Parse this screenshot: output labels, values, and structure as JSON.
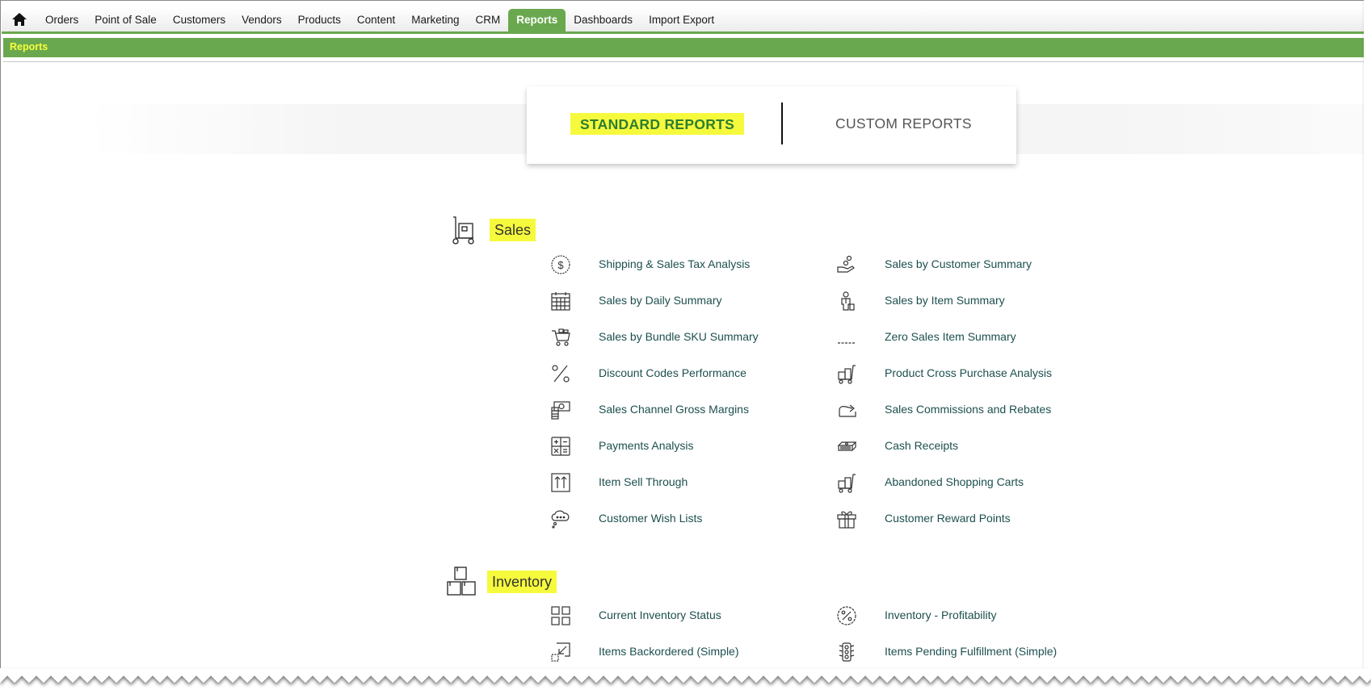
{
  "nav": {
    "home_icon": "home-icon",
    "items": [
      "Orders",
      "Point of Sale",
      "Customers",
      "Vendors",
      "Products",
      "Content",
      "Marketing",
      "CRM",
      "Reports",
      "Dashboards",
      "Import Export"
    ],
    "active": "Reports"
  },
  "breadcrumb": "Reports",
  "tabs": {
    "standard": "STANDARD REPORTS",
    "custom": "CUSTOM REPORTS",
    "active": "STANDARD REPORTS"
  },
  "colors": {
    "accent": "#6aa84f",
    "highlight": "#f6fa3c",
    "link": "#1d4f4f",
    "active_tab_text": "#2e7d32"
  },
  "sections": [
    {
      "title": "Sales",
      "icon": "hand-truck-icon",
      "reports": [
        {
          "label": "Shipping & Sales Tax Analysis",
          "icon": "dollar-coin-icon"
        },
        {
          "label": "Sales by Customer Summary",
          "icon": "hand-coins-icon"
        },
        {
          "label": "Sales by Daily Summary",
          "icon": "calendar-icon"
        },
        {
          "label": "Sales by Item Summary",
          "icon": "person-icon"
        },
        {
          "label": "Sales by Bundle SKU Summary",
          "icon": "shopping-cart-icon"
        },
        {
          "label": "Zero Sales Item Summary",
          "icon": "dashes-icon"
        },
        {
          "label": "Discount Codes Performance",
          "icon": "percent-icon"
        },
        {
          "label": "Product Cross Purchase Analysis",
          "icon": "cart-boxes-icon"
        },
        {
          "label": "Sales Channel Gross Margins",
          "icon": "cash-stack-icon"
        },
        {
          "label": "Sales Commissions and Rebates",
          "icon": "return-arrow-icon"
        },
        {
          "label": "Payments Analysis",
          "icon": "calculator-icon"
        },
        {
          "label": "Cash Receipts",
          "icon": "money-stack-icon"
        },
        {
          "label": "Item Sell Through",
          "icon": "up-arrows-box-icon"
        },
        {
          "label": "Abandoned Shopping Carts",
          "icon": "cart-boxes-icon"
        },
        {
          "label": "Customer Wish Lists",
          "icon": "thought-bubble-icon"
        },
        {
          "label": "Customer Reward Points",
          "icon": "gift-icon"
        }
      ]
    },
    {
      "title": "Inventory",
      "icon": "stacked-boxes-icon",
      "reports": [
        {
          "label": "Current Inventory Status",
          "icon": "grid-icon"
        },
        {
          "label": "Inventory - Profitability",
          "icon": "percent-badge-icon"
        },
        {
          "label": "Items Backordered (Simple)",
          "icon": "shrink-arrow-icon"
        },
        {
          "label": "Items Pending Fulfillment (Simple)",
          "icon": "traffic-light-icon"
        }
      ]
    }
  ]
}
